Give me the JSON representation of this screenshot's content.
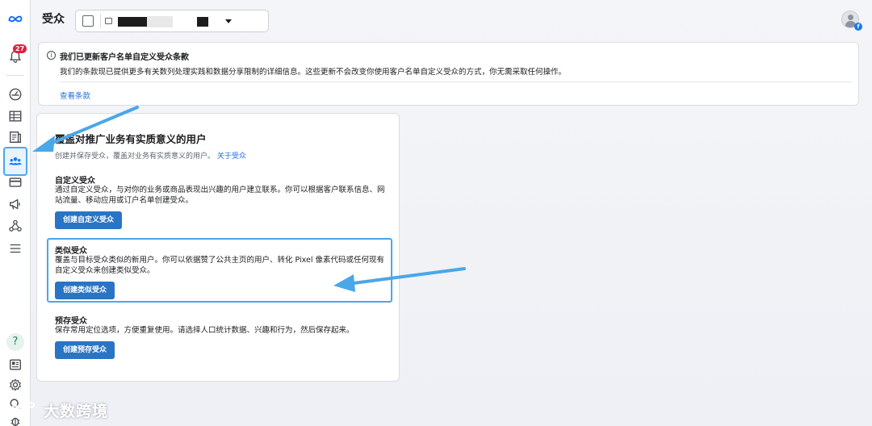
{
  "header": {
    "title": "受众"
  },
  "notice": {
    "title": "我们已更新客户名单自定义受众条款",
    "body": "我们的条款现已提供更多有关数列处理实践和数据分享限制的详细信息。这些更新不会改变你使用客户名单自定义受众的方式，你无需采取任何操作。",
    "link": "查看条款"
  },
  "sidebar": {
    "notification_count": "27",
    "help_glyph": "?"
  },
  "main": {
    "title": "覆盖对推广业务有实质意义的用户",
    "subtitle": "创建并保存受众，覆盖对业务有实质意义的用户。",
    "subtitle_link": "关于受众",
    "sections": [
      {
        "title": "自定义受众",
        "description": "通过自定义受众，与对你的业务或商品表现出兴趣的用户建立联系。你可以根据客户联系信息、网站流量、移动应用或订户名单创建受众。",
        "button": "创建自定义受众"
      },
      {
        "title": "类似受众",
        "description": "覆盖与目标受众类似的新用户。你可以依据赞了公共主页的用户、转化 Pixel 像素代码或任何现有自定义受众来创建类似受众。",
        "button": "创建类似受众"
      },
      {
        "title": "预存受众",
        "description": "保存常用定位选项，方便重复使用。请选择人口统计数据、兴趣和行为，然后保存起来。",
        "button": "创建预存受众"
      }
    ]
  },
  "watermark": {
    "text": "大数跨境"
  },
  "colors": {
    "primary_button": "#2a74c4",
    "link": "#216fdb",
    "annotation": "#4aa7e8",
    "badge": "#e41e3f"
  }
}
